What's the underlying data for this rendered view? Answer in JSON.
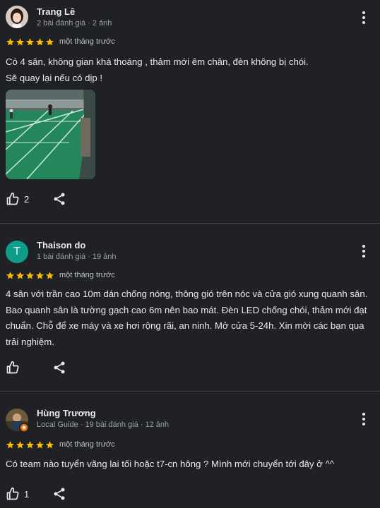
{
  "reviews": [
    {
      "name": "Trang Lê",
      "meta": "2 bài đánh giá · 2 ảnh",
      "rating": 5,
      "time": "một tháng trước",
      "text_lines": [
        "Có 4 sân, không gian khá thoáng , thảm mới êm chân, đèn không bị chói.",
        "Sẽ quay lại nếu có dịp !"
      ],
      "likes": "2"
    },
    {
      "name": "Thaison do",
      "avatar_letter": "T",
      "avatar_color": "#0f9d8a",
      "meta": "1 bài đánh giá · 19 ảnh",
      "rating": 5,
      "time": "một tháng trước",
      "text": "4 sân với trần cao 10m dán chống nóng, thông gió trên nóc và cửa gió xung quanh sân. Bao quanh sân là tường gạch cao 6m nên bao mát. Đèn LED chống chói, thảm mới đạt chuẩn. Chỗ để xe máy và xe hơi rộng rãi, an ninh. Mở cửa 5-24h. Xin mời các bạn qua trải nghiệm.",
      "likes": ""
    },
    {
      "name": "Hùng Trương",
      "meta": "Local Guide · 19 bài đánh giá · 12 ảnh",
      "rating": 5,
      "time": "một tháng trước",
      "text": "Có team nào tuyển vãng lai tối hoặc t7-cn hông ? Mình mới chuyển tới đây ở ^^",
      "likes": "1"
    }
  ],
  "colors": {
    "star": "#fbbc04",
    "background": "#202124",
    "divider": "#3c4043"
  }
}
